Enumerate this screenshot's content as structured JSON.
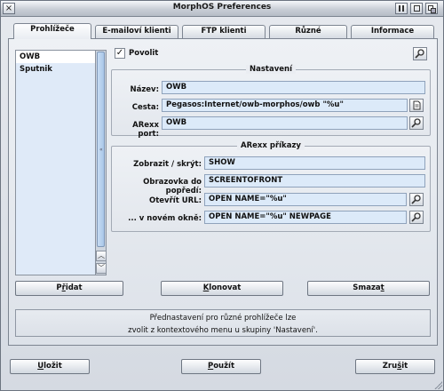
{
  "window": {
    "title": "MorphOS Preferences",
    "close_glyph": "×"
  },
  "tabs": [
    {
      "label": "Prohlížeče",
      "active": true
    },
    {
      "label": "E-mailoví klienti",
      "active": false
    },
    {
      "label": "FTP klienti",
      "active": false
    },
    {
      "label": "Různé",
      "active": false
    },
    {
      "label": "Informace",
      "active": false
    }
  ],
  "browser_list": {
    "items": [
      "OWB",
      "Sputnik"
    ],
    "selected_index": 0
  },
  "enable": {
    "label": "Povolit",
    "checked": true,
    "check_glyph": "✓"
  },
  "settings": {
    "title": "Nastavení",
    "name_label": "Název:",
    "name_value": "OWB",
    "path_label": "Cesta:",
    "path_value": "Pegasos:Internet/owb-morphos/owb \"%u\"",
    "arexx_port_label": "ARexx port:",
    "arexx_port_value": "OWB"
  },
  "arexx": {
    "title": "ARexx příkazy",
    "show_label": "Zobrazit / skrýt:",
    "show_value": "SHOW",
    "front_label": "Obrazovka do popředí:",
    "front_value": "SCREENTOFRONT",
    "open_url_label": "Otevřít URL:",
    "open_url_value": "OPEN NAME=\"%u\"",
    "new_page_label": "... v novém okně:",
    "new_page_value": "OPEN NAME=\"%u\" NEWPAGE"
  },
  "list_buttons": {
    "add_pre": "P",
    "add_key": "ř",
    "add_post": "idat",
    "clone_pre": "",
    "clone_key": "K",
    "clone_post": "lonovat",
    "delete_pre": "Smaza",
    "delete_key": "t",
    "delete_post": ""
  },
  "info": {
    "line1": "Přednastavení pro různé prohlížeče lze",
    "line2": "zvolit z kontextového menu u skupiny 'Nastavení'."
  },
  "footer": {
    "save_pre": "",
    "save_key": "U",
    "save_post": "ložit",
    "use_pre": "",
    "use_key": "P",
    "use_post": "oužít",
    "cancel_pre": "Zru",
    "cancel_key": "š",
    "cancel_post": "it"
  },
  "scroll": {
    "up_glyph": "︿",
    "down_glyph": "﹀",
    "grip_glyph": "«"
  },
  "colors": {
    "field_bg": "#dceaf9",
    "list_bg": "#dfeaf8",
    "thumb": "#a9c6e8"
  }
}
